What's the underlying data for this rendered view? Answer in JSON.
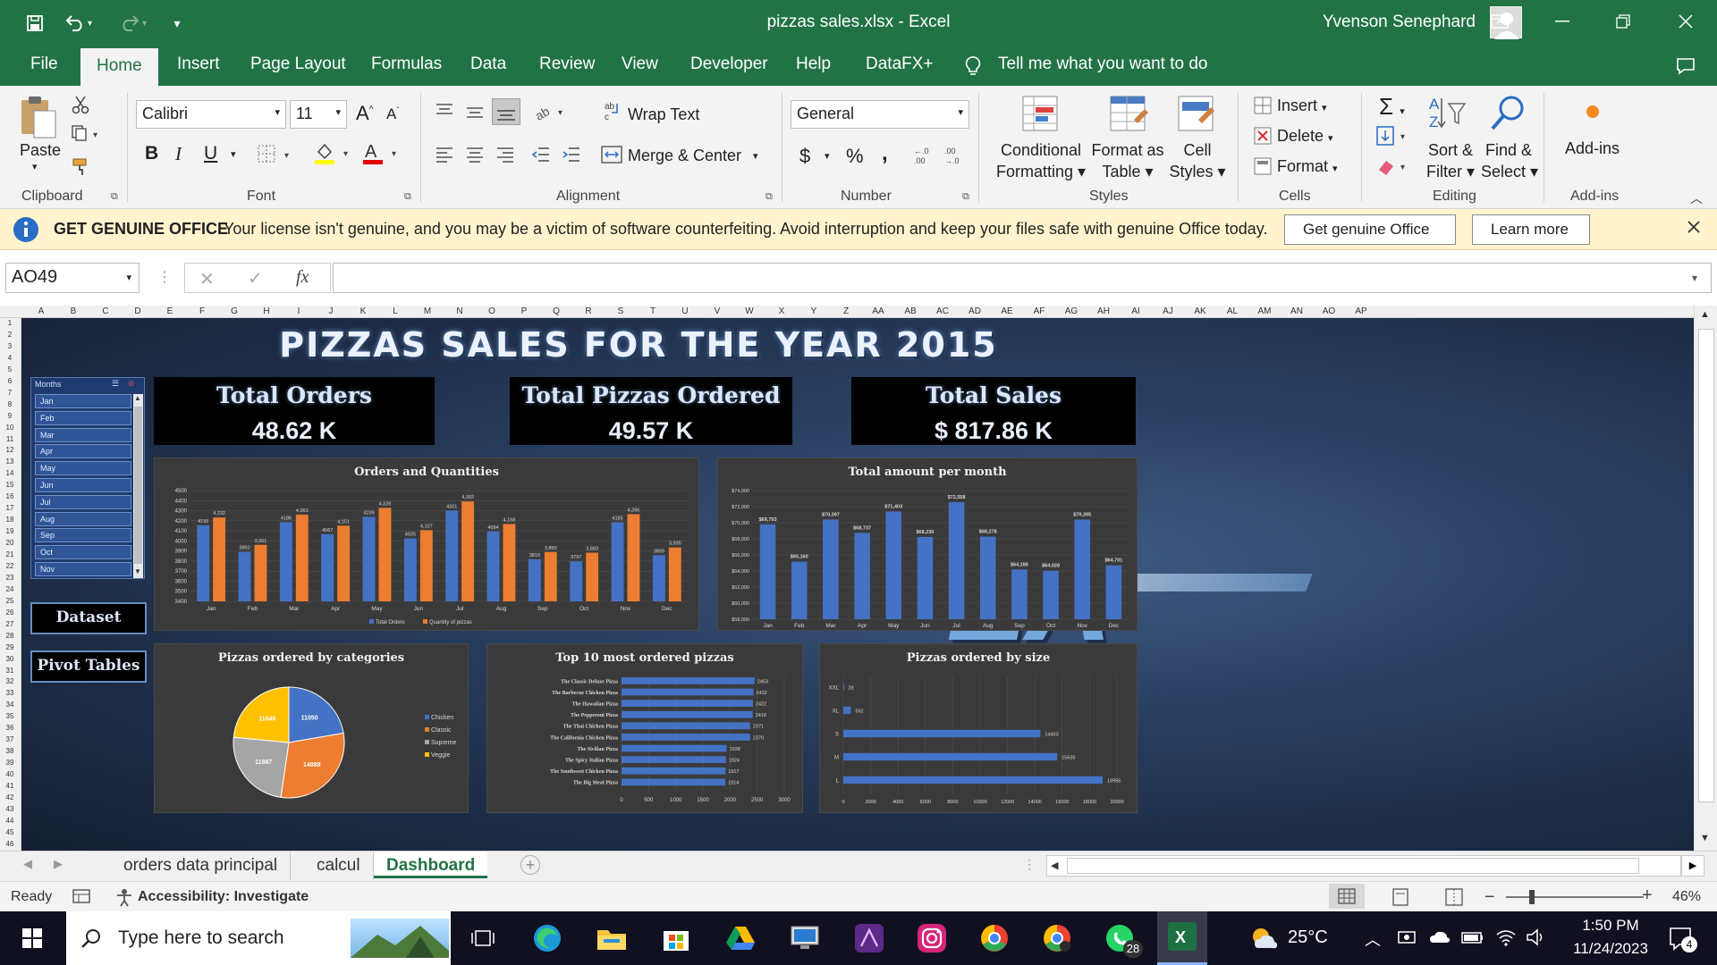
{
  "window": {
    "title": "pizzas sales.xlsx  -  Excel",
    "user": "Yvenson Senephard"
  },
  "tabs": [
    "File",
    "Home",
    "Insert",
    "Page Layout",
    "Formulas",
    "Data",
    "Review",
    "View",
    "Developer",
    "Help",
    "DataFX+"
  ],
  "tell_me": "Tell me what you want to do",
  "ribbon": {
    "clipboard": {
      "paste": "Paste",
      "label": "Clipboard"
    },
    "font": {
      "name": "Calibri",
      "size": "11",
      "label": "Font"
    },
    "alignment": {
      "wrap": "Wrap Text",
      "merge": "Merge & Center",
      "label": "Alignment"
    },
    "number": {
      "format": "General",
      "label": "Number"
    },
    "styles": {
      "cond1": "Conditional",
      "cond2": "Formatting",
      "fmt1": "Format as",
      "fmt2": "Table",
      "cell1": "Cell",
      "cell2": "Styles",
      "label": "Styles"
    },
    "cells": {
      "insert": "Insert",
      "delete": "Delete",
      "format": "Format",
      "label": "Cells"
    },
    "editing": {
      "sort1": "Sort &",
      "sort2": "Filter",
      "find1": "Find &",
      "find2": "Select",
      "label": "Editing"
    },
    "addins": {
      "btn": "Add-ins",
      "label": "Add-ins"
    }
  },
  "message": {
    "title": "GET GENUINE OFFICE",
    "text": "Your license isn't genuine, and you may be a victim of software counterfeiting. Avoid interruption and keep your files safe with genuine Office today.",
    "btn1": "Get genuine Office",
    "btn2": "Learn more"
  },
  "formula": {
    "namebox": "AO49",
    "fx": "fx",
    "content": ""
  },
  "columns": [
    "A",
    "B",
    "C",
    "D",
    "E",
    "F",
    "G",
    "H",
    "I",
    "J",
    "K",
    "L",
    "M",
    "N",
    "O",
    "P",
    "Q",
    "R",
    "S",
    "T",
    "U",
    "V",
    "W",
    "X",
    "Y",
    "Z",
    "AA",
    "AB",
    "AC",
    "AD",
    "AE",
    "AF",
    "AG",
    "AH",
    "AI",
    "AJ",
    "AK",
    "AL",
    "AM",
    "AN",
    "AO",
    "AP"
  ],
  "dashboard": {
    "title": "PIZZAS SALES FOR THE YEAR 2015",
    "kpis": [
      {
        "label": "Total Orders",
        "value": "48.62 K"
      },
      {
        "label": "Total Pizzas Ordered",
        "value": "49.57 K"
      },
      {
        "label": "Total Sales",
        "value": "$ 817.86 K"
      }
    ],
    "slicer": {
      "title": "Months",
      "items": [
        "Jan",
        "Feb",
        "Mar",
        "Apr",
        "May",
        "Jun",
        "Jul",
        "Aug",
        "Sep",
        "Oct",
        "Nov"
      ]
    },
    "buttons": {
      "dataset": "Dataset",
      "pivot": "Pivot Tables"
    },
    "bg_text": "ZA"
  },
  "chart_data": [
    {
      "type": "bar",
      "title": "Orders and Quantities",
      "categories": [
        "Jan",
        "Feb",
        "Mar",
        "Apr",
        "May",
        "Jun",
        "Jul",
        "Aug",
        "Sep",
        "Oct",
        "Nov",
        "Dec"
      ],
      "series": [
        {
          "name": "Total Orders",
          "color": "#4472c4",
          "values": [
            4156,
            3892,
            4186,
            4067,
            4239,
            4025,
            4301,
            4094,
            3819,
            3797,
            4185,
            3859
          ]
        },
        {
          "name": "Quantity of pizzas",
          "color": "#ed7d31",
          "values": [
            4232,
            3961,
            4261,
            4151,
            4328,
            4107,
            4392,
            4168,
            3890,
            3883,
            4266,
            3935
          ]
        }
      ],
      "value_labels": {
        "Total Orders": [
          "4156",
          "3892",
          "4186",
          "4067",
          "4239",
          "4025",
          "4301",
          "4094",
          "3819",
          "3797",
          "4185",
          "3859"
        ],
        "Quantity of pizzas": [
          "4,232",
          "3,961",
          "4,261",
          "4,151",
          "4,328",
          "4,107",
          "4,392",
          "4,168",
          "3,890",
          "3,883",
          "4,266",
          "3,935"
        ]
      },
      "ylim": [
        3400,
        4500
      ],
      "yticks": [
        "3400",
        "3500",
        "3600",
        "3700",
        "3800",
        "3900",
        "4000",
        "4100",
        "4200",
        "4300",
        "4400",
        "4500"
      ],
      "legend": "bottom"
    },
    {
      "type": "bar",
      "title": "Total amount per month",
      "categories": [
        "Jan",
        "Feb",
        "Mar",
        "Apr",
        "May",
        "Jun",
        "Jul",
        "Aug",
        "Sep",
        "Oct",
        "Nov",
        "Dec"
      ],
      "series": [
        {
          "name": "",
          "color": "#4472c4",
          "values": [
            69793,
            65160,
            70397,
            68737,
            71403,
            68230,
            72558,
            68278,
            64180,
            64028,
            70395,
            64701
          ]
        }
      ],
      "value_labels": [
        "$69,793",
        "$65,160",
        "$70,397",
        "$68,737",
        "$71,403",
        "$68,230",
        "$72,558",
        "$68,278",
        "$64,180",
        "$64,028",
        "$70,395",
        "$64,701"
      ],
      "ylim": [
        58000,
        74000
      ],
      "yticks": [
        "$58,000",
        "$60,000",
        "$62,000",
        "$64,000",
        "$66,000",
        "$68,000",
        "$70,000",
        "$72,000",
        "$74,000"
      ]
    },
    {
      "type": "pie",
      "title": "Pizzas ordered by categories",
      "categories": [
        "Chicken",
        "Classic",
        "Supreme",
        "Veggie"
      ],
      "values": [
        11050,
        14888,
        11987,
        11649
      ],
      "labels": [
        "11050",
        "14888",
        "11987",
        "11649"
      ],
      "colors": [
        "#4472c4",
        "#ed7d31",
        "#a5a5a5",
        "#ffc000"
      ],
      "legend": "right"
    },
    {
      "type": "bar",
      "title": "Top 10 most ordered pizzas",
      "orientation": "horizontal",
      "categories": [
        "The Classic Deluxe Pizza",
        "The Barbecue Chicken Pizza",
        "The Hawaiian Pizza",
        "The Pepperoni Pizza",
        "The Thai Chicken Pizza",
        "The California Chicken Pizza",
        "The Sicilian Pizza",
        "The Spicy Italian Pizza",
        "The Southwest Chicken Pizza",
        "The Big Meat Pizza"
      ],
      "values": [
        2453,
        2432,
        2422,
        2418,
        2371,
        2370,
        1938,
        1924,
        1917,
        1914
      ],
      "value_labels": [
        "2453",
        "2432",
        "2422",
        "2418",
        "2371",
        "2370",
        "1938",
        "1924",
        "1917",
        "1914"
      ],
      "xlim": [
        0,
        3000
      ],
      "xticks": [
        "0",
        "500",
        "1000",
        "1500",
        "2000",
        "2500",
        "3000"
      ]
    },
    {
      "type": "bar",
      "title": "Pizzas ordered by size",
      "orientation": "horizontal",
      "categories": [
        "XXL",
        "XL",
        "S",
        "M",
        "L"
      ],
      "values": [
        28,
        552,
        14403,
        15635,
        18956
      ],
      "value_labels": [
        "28",
        "552",
        "14403",
        "15635",
        "18956"
      ],
      "xlim": [
        0,
        20000
      ],
      "xticks": [
        "0",
        "2000",
        "4000",
        "6000",
        "8000",
        "10000",
        "12000",
        "14000",
        "16000",
        "18000",
        "20000"
      ]
    }
  ],
  "sheets": [
    "orders data principal",
    "calcul",
    "Dashboard"
  ],
  "status": {
    "ready": "Ready",
    "access": "Accessibility: Investigate",
    "zoom": "46%"
  },
  "taskbar": {
    "search": "Type here to search",
    "temp": "25°C",
    "time": "1:50 PM",
    "date": "11/24/2023",
    "badge": "28",
    "notif": "4"
  }
}
